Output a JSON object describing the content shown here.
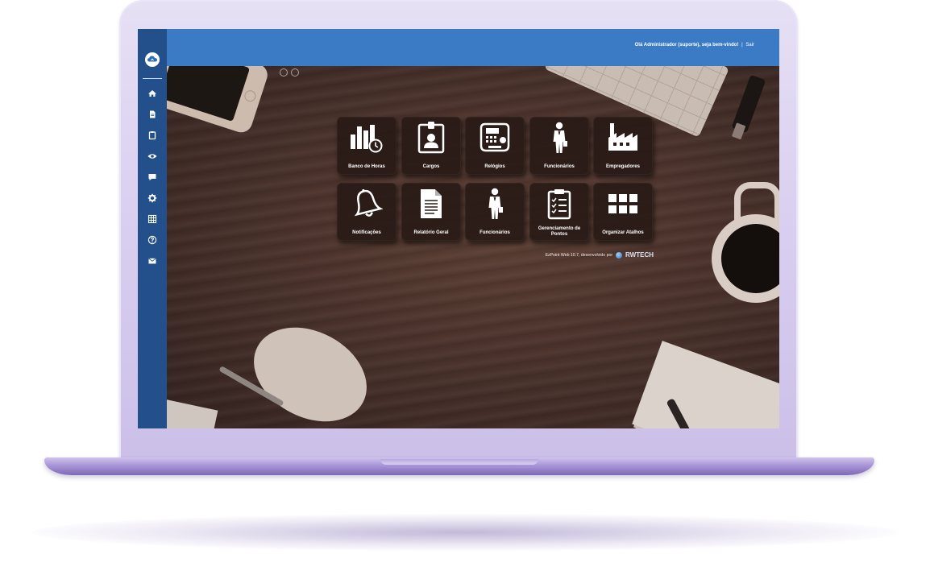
{
  "header": {
    "greeting": "Olá Administrador (suporte), seja bem-vindo!",
    "separator": "|",
    "logout_label": "Sair"
  },
  "sidebar": {
    "logo_icon": "cloud-icon",
    "items": [
      {
        "name": "home",
        "icon": "home-icon"
      },
      {
        "name": "documents",
        "icon": "document-icon"
      },
      {
        "name": "clipboard",
        "icon": "clipboard-icon"
      },
      {
        "name": "view",
        "icon": "eye-icon"
      },
      {
        "name": "messages",
        "icon": "chat-icon"
      },
      {
        "name": "settings",
        "icon": "gear-icon"
      },
      {
        "name": "grid",
        "icon": "table-icon"
      },
      {
        "name": "help",
        "icon": "help-icon"
      },
      {
        "name": "mail",
        "icon": "mail-icon"
      }
    ]
  },
  "tiles": [
    {
      "label": "Banco de Horas",
      "icon": "bar-chart-clock-icon"
    },
    {
      "label": "Cargos",
      "icon": "id-badge-icon"
    },
    {
      "label": "Relógios",
      "icon": "time-clock-device-icon"
    },
    {
      "label": "Funcionários",
      "icon": "employee-icon"
    },
    {
      "label": "Empregadores",
      "icon": "factory-icon"
    },
    {
      "label": "Notificações",
      "icon": "bell-icon"
    },
    {
      "label": "Relatório Geral",
      "icon": "report-document-icon"
    },
    {
      "label": "Funcionários",
      "icon": "employee-icon"
    },
    {
      "label": "Gerenciamento de Pontos",
      "icon": "checklist-icon"
    },
    {
      "label": "Organizar Atalhos",
      "icon": "grid-icon"
    }
  ],
  "footer": {
    "credit": "EzPoint Web 10.7, desenvolvido por",
    "brand": "RWTECH"
  },
  "colors": {
    "sidebar": "#23508a",
    "topbar": "#3b7ac4",
    "tile": "#2c1d19"
  }
}
